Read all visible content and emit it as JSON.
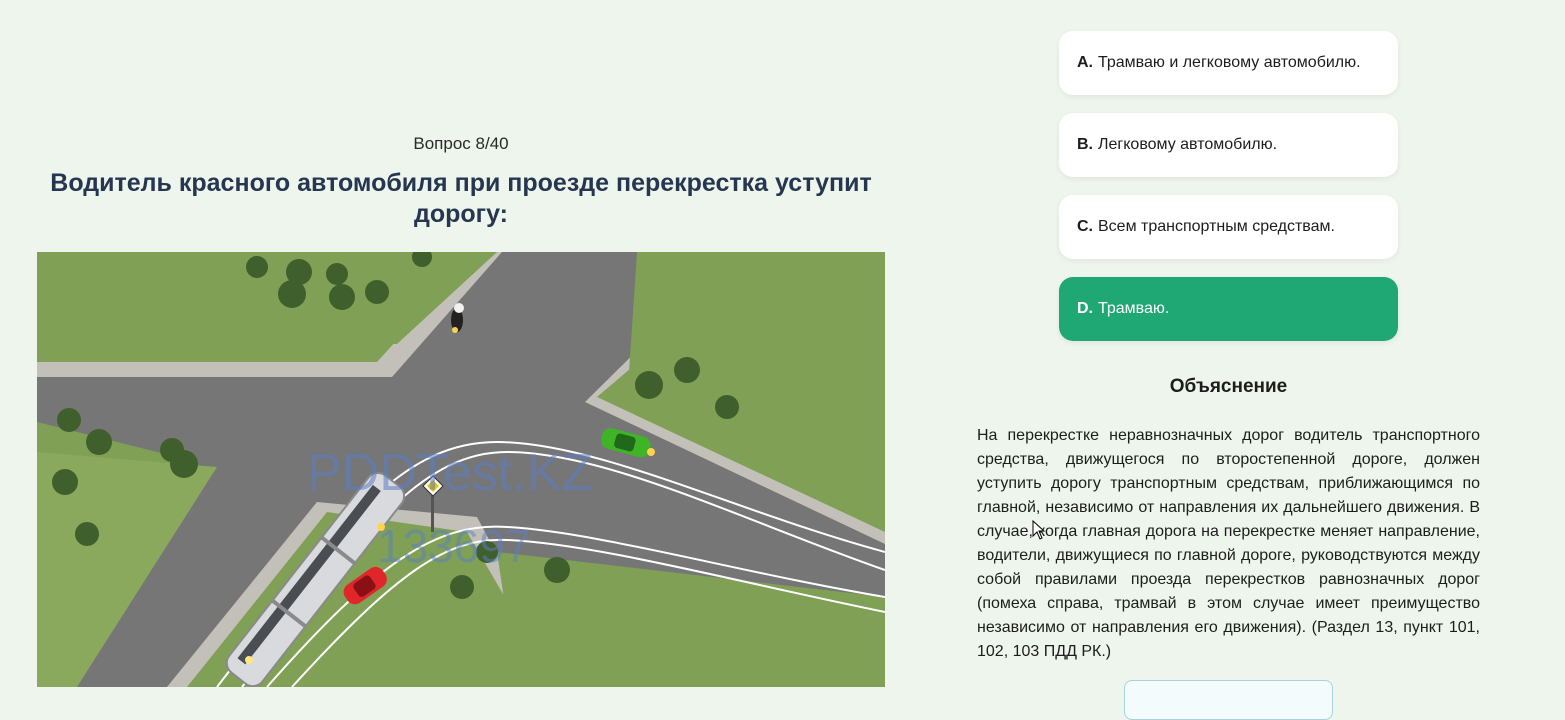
{
  "question": {
    "counter": "Вопрос 8/40",
    "title": "Водитель красного автомобиля при проезде перекрестка уступит дорогу:"
  },
  "scene": {
    "watermark_line1": "PDDTest.KZ",
    "watermark_line2": "133697",
    "colors": {
      "grass": "#7fa055",
      "road": "#767676",
      "sidewalk": "#c3c0ba",
      "red_car": "#e0252b",
      "green_car": "#3fb427",
      "tram": "#d9dadd"
    }
  },
  "answers": [
    {
      "letter": "A.",
      "text": "Трамваю и легковому автомобилю.",
      "correct": false
    },
    {
      "letter": "B.",
      "text": "Легковому автомобилю.",
      "correct": false
    },
    {
      "letter": "C.",
      "text": "Всем транспортным средствам.",
      "correct": false
    },
    {
      "letter": "D.",
      "text": "Трамваю.",
      "correct": true
    }
  ],
  "explanation": {
    "heading": "Объяснение",
    "text": "На перекрестке неравнозначных дорог водитель транспортного средства, движущегося по второстепенной дороге, должен уступить дорогу транспортным средствам, приближающимся по главной, независимо от направления их дальнейшего движения. В случае, когда главная дорога на перекрестке меняет направление, водители, движущиеся по главной дороге, руководствуются между собой правилами проезда перекрестков равнозначных дорог (помеха справа, трамвай в этом случае имеет преимущество независимо от направления его движения). (Раздел 13, пункт 101, 102, 103 ПДД РК.)"
  },
  "theme": {
    "background": "#eef5ec",
    "correct_answer": "#1fa874",
    "title_color": "#263650"
  }
}
